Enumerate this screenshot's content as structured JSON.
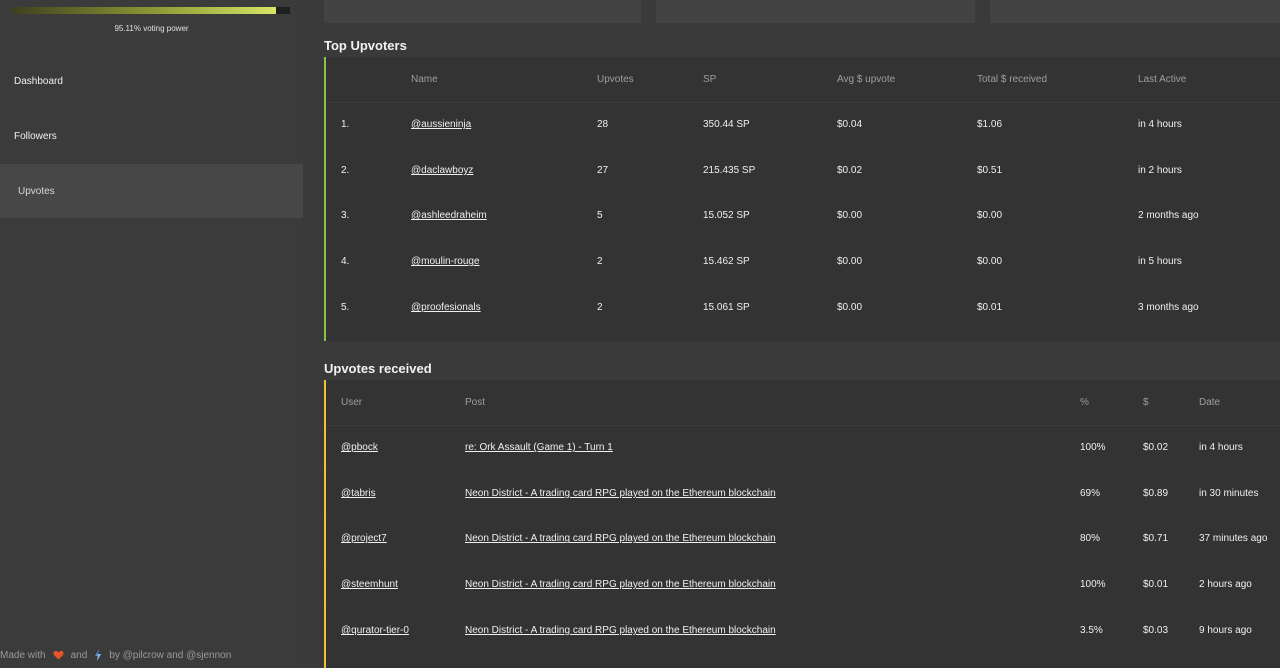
{
  "sidebar": {
    "voting_power_label": "95.11% voting power",
    "voting_power_fraction": 0.9511,
    "nav": [
      {
        "label": "Dashboard"
      },
      {
        "label": "Followers"
      },
      {
        "label": "Upvotes"
      }
    ],
    "footer": {
      "made_with": "Made with",
      "and": "and",
      "by": "by @pilcrow and @sjennon",
      "heart_icon": "heart-icon",
      "second_icon": "react-icon"
    }
  },
  "top_upvoters": {
    "title": "Top Upvoters",
    "columns": [
      "",
      "Name",
      "Upvotes",
      "SP",
      "Avg $ upvote",
      "Total $ received",
      "Last Active"
    ],
    "rows": [
      {
        "rank": "1.",
        "name": "@aussieninja",
        "upvotes": "28",
        "sp": "350.44 SP",
        "avg": "$0.04",
        "total": "$1.06",
        "last_active": "in 4 hours"
      },
      {
        "rank": "2.",
        "name": "@daclawboyz",
        "upvotes": "27",
        "sp": "215.435 SP",
        "avg": "$0.02",
        "total": "$0.51",
        "last_active": "in 2 hours"
      },
      {
        "rank": "3.",
        "name": "@ashleedraheim",
        "upvotes": "5",
        "sp": "15.052 SP",
        "avg": "$0.00",
        "total": "$0.00",
        "last_active": "2 months ago"
      },
      {
        "rank": "4.",
        "name": "@moulin-rouge",
        "upvotes": "2",
        "sp": "15.462 SP",
        "avg": "$0.00",
        "total": "$0.00",
        "last_active": "in 5 hours"
      },
      {
        "rank": "5.",
        "name": "@proofesionals",
        "upvotes": "2",
        "sp": "15.061 SP",
        "avg": "$0.00",
        "total": "$0.01",
        "last_active": "3 months ago"
      }
    ]
  },
  "upvotes_received": {
    "title": "Upvotes received",
    "columns": [
      "User",
      "Post",
      "%",
      "$",
      "Date"
    ],
    "rows": [
      {
        "user": "@pbock",
        "post": "re: Ork Assault (Game 1) - Turn 1",
        "pct": "100%",
        "usd": "$0.02",
        "date": "in 4 hours"
      },
      {
        "user": "@tabris",
        "post": "Neon District - A trading card RPG played on the Ethereum blockchain",
        "pct": "69%",
        "usd": "$0.89",
        "date": "in 30 minutes"
      },
      {
        "user": "@project7",
        "post": "Neon District - A trading card RPG played on the Ethereum blockchain",
        "pct": "80%",
        "usd": "$0.71",
        "date": "37 minutes ago"
      },
      {
        "user": "@steemhunt",
        "post": "Neon District - A trading card RPG played on the Ethereum blockchain",
        "pct": "100%",
        "usd": "$0.01",
        "date": "2 hours ago"
      },
      {
        "user": "@qurator-tier-0",
        "post": "Neon District - A trading card RPG played on the Ethereum blockchain",
        "pct": "3.5%",
        "usd": "$0.03",
        "date": "9 hours ago"
      }
    ]
  },
  "colors": {
    "upvoters_accent": "#8bc34a",
    "received_accent": "#f1c232"
  }
}
